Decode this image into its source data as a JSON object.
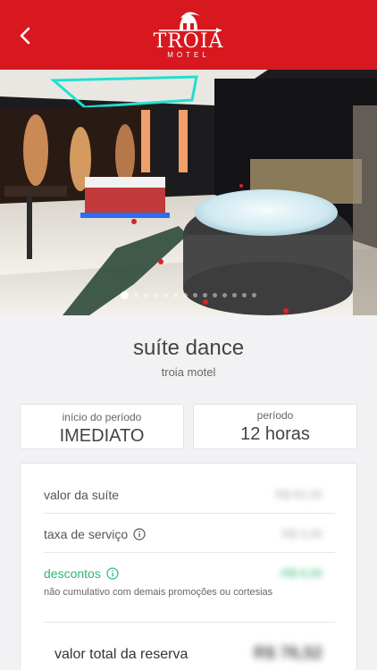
{
  "header": {
    "logo_main": "TROIA",
    "logo_sub": "MOTEL",
    "back_icon": "chevron-left-icon",
    "brand_color": "#d8181f"
  },
  "gallery": {
    "image_alt": "suíte dance com hidromassagem e cama",
    "dot_count": 14,
    "active_index": 0
  },
  "suite": {
    "name": "suíte dance",
    "motel": "troia motel"
  },
  "period_start": {
    "label": "início do período",
    "value": "IMEDIATO"
  },
  "period": {
    "label": "período",
    "value": "12 horas"
  },
  "summary": {
    "suite_value_label": "valor da suíte",
    "suite_value": "R$ 82,00",
    "service_fee_label": "taxa de serviço",
    "service_fee_value": "R$ 0,00",
    "discounts_label": "descontos",
    "discounts_value": "-R$ 6,00",
    "discounts_note": "não cumulativo com demais promoções ou cortesias",
    "total_label": "valor total da reserva",
    "total_value": "R$ 76,52",
    "accent_green": "#2bb673"
  }
}
